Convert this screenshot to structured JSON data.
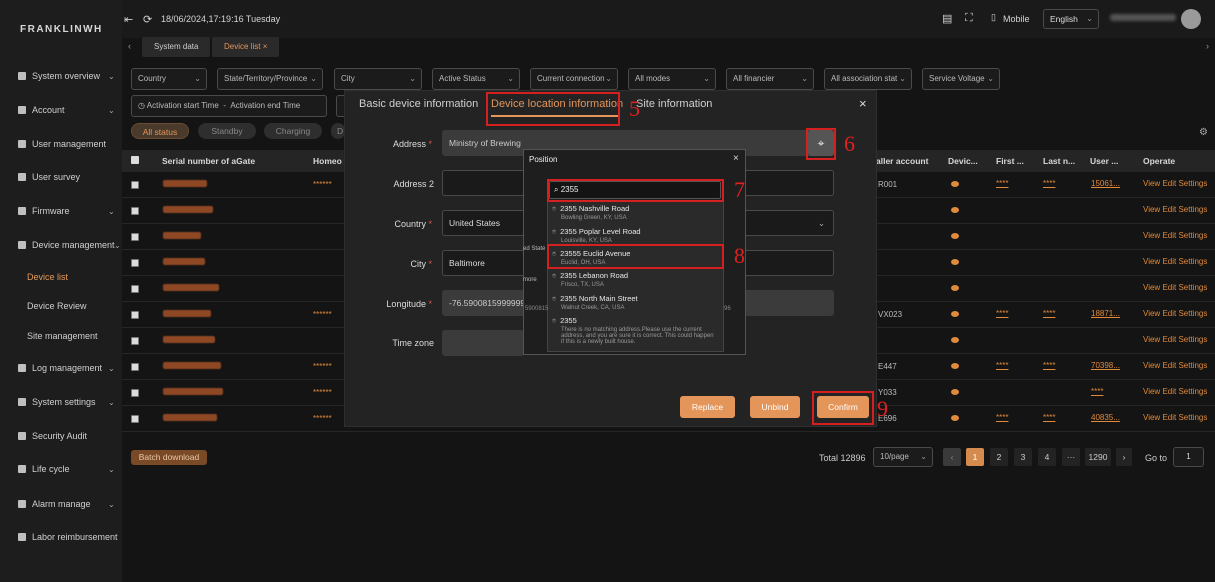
{
  "brand": "FRANKLINWH",
  "topbar": {
    "datetime": "18/06/2024,17:19:16 Tuesday",
    "mobile_label": "Mobile",
    "language": "English"
  },
  "tabs": [
    {
      "label": "System data"
    },
    {
      "label": "Device list",
      "close": "×"
    }
  ],
  "sidebar": {
    "items": [
      {
        "label": "System overview",
        "chevron": "⌄",
        "icon": "monitor-icon"
      },
      {
        "label": "Account",
        "chevron": "⌄",
        "icon": "account-icon"
      },
      {
        "label": "User management",
        "icon": "users-icon"
      },
      {
        "label": "User survey",
        "icon": "chart-icon"
      },
      {
        "label": "Firmware",
        "chevron": "⌄",
        "icon": "firmware-icon"
      },
      {
        "label": "Device management",
        "chevron": "⌄",
        "icon": "document-icon"
      },
      {
        "label": "Log management",
        "chevron": "⌄",
        "icon": "log-icon"
      },
      {
        "label": "System settings",
        "chevron": "⌄",
        "icon": "gear-icon"
      },
      {
        "label": "Security Audit",
        "icon": "shield-icon"
      },
      {
        "label": "Life cycle",
        "chevron": "⌄",
        "icon": "cycle-icon"
      },
      {
        "label": "Alarm manage",
        "chevron": "⌄",
        "icon": "bell-icon"
      },
      {
        "label": "Labor reimbursement",
        "icon": "money-icon"
      }
    ],
    "sub_items": [
      {
        "label": "Device list",
        "active": true
      },
      {
        "label": "Device Review"
      },
      {
        "label": "Site management"
      }
    ]
  },
  "filters": {
    "row1": [
      "Country",
      "State/Territory/Province",
      "City",
      "Active Status",
      "Current connection",
      "All modes",
      "All financier",
      "All association stat",
      "Service Voltage"
    ],
    "activation_start": "Activation start Time",
    "separator": "-",
    "activation_end": "Activation end Time"
  },
  "status_pills": [
    "All status",
    "Standby",
    "Charging",
    "D"
  ],
  "table": {
    "headers": {
      "serial": "Serial number of aGate",
      "homeo": "Homeo",
      "installer": "aller account",
      "device": "Devic...",
      "first": "First ...",
      "last": "Last n...",
      "user": "User ...",
      "operate": "Operate"
    },
    "rows": [
      {
        "homeo": "******",
        "tail": "R001",
        "first": "****",
        "last": "****",
        "user": "15061..."
      },
      {
        "homeo": "",
        "tail": "",
        "first": "",
        "last": "",
        "user": ""
      },
      {
        "homeo": "",
        "tail": "",
        "first": "",
        "last": "",
        "user": ""
      },
      {
        "homeo": "",
        "tail": "",
        "first": "",
        "last": "",
        "user": ""
      },
      {
        "homeo": "",
        "tail": "",
        "first": "",
        "last": "",
        "user": ""
      },
      {
        "homeo": "******",
        "tail": "VX023",
        "first": "****",
        "last": "****",
        "user": "18871..."
      },
      {
        "homeo": "",
        "tail": "",
        "first": "",
        "last": "",
        "user": ""
      },
      {
        "homeo": "******",
        "tail": "E447",
        "first": "****",
        "last": "****",
        "user": "70398..."
      },
      {
        "homeo": "******",
        "tail": "Y033",
        "first": "",
        "last": "",
        "user": "****"
      },
      {
        "homeo": "******",
        "tail": "E696",
        "first": "****",
        "last": "****",
        "user": "40835..."
      }
    ],
    "op_view": "View",
    "op_edit": "Edit",
    "op_settings": "Settings"
  },
  "batch_download": "Batch download",
  "pagination": {
    "total": "Total 12896",
    "per_page": "10/page",
    "pages": [
      "1",
      "2",
      "3",
      "4",
      "···",
      "1290"
    ],
    "goto_label": "Go to",
    "goto_value": "1"
  },
  "dialog": {
    "tabs": [
      "Basic device information",
      "Device location information",
      "Site information"
    ],
    "close": "×",
    "fields": {
      "address_label": "Address",
      "address_value": "Ministry of Brewing",
      "address2_label": "Address 2",
      "country_label": "Country",
      "country_value": "United States",
      "city_label": "City",
      "city_value": "Baltimore",
      "longitude_label": "Longitude",
      "longitude_value": "-76.59008159999999",
      "timezone_label": "Time zone"
    },
    "buttons": {
      "replace": "Replace",
      "unbind": "Unbind",
      "confirm": "Confirm"
    },
    "peek_right": "..."
  },
  "position_popup": {
    "title": "Position",
    "close": "×",
    "search_value": "2355",
    "options": [
      {
        "line1": "2355 Nashville Road",
        "line2": "Bowling Green, KY, USA"
      },
      {
        "line1": "2355 Poplar Level Road",
        "line2": "Louisville, KY, USA"
      },
      {
        "line1": "23555 Euclid Avenue",
        "line2": "Euclid, OH, USA"
      },
      {
        "line1": "2355 Lebanon Road",
        "line2": "Frisco, TX, USA"
      },
      {
        "line1": "2355 North Main Street",
        "line2": "Walnut Creek, CA, USA"
      },
      {
        "line1": "2355",
        "line2": "There is no matching address.Please use the current address, and you are sure it is correct. This could happen if this is a newly built house."
      }
    ],
    "peek_left": "ed State",
    "peek_more": "more",
    "peek_num": "5900815",
    "peek_right_num": "96"
  },
  "annotations": [
    "5",
    "6",
    "7",
    "8",
    "9"
  ],
  "colors": {
    "accent": "#e3955a",
    "annotation": "#d42020",
    "background": "#141414"
  }
}
